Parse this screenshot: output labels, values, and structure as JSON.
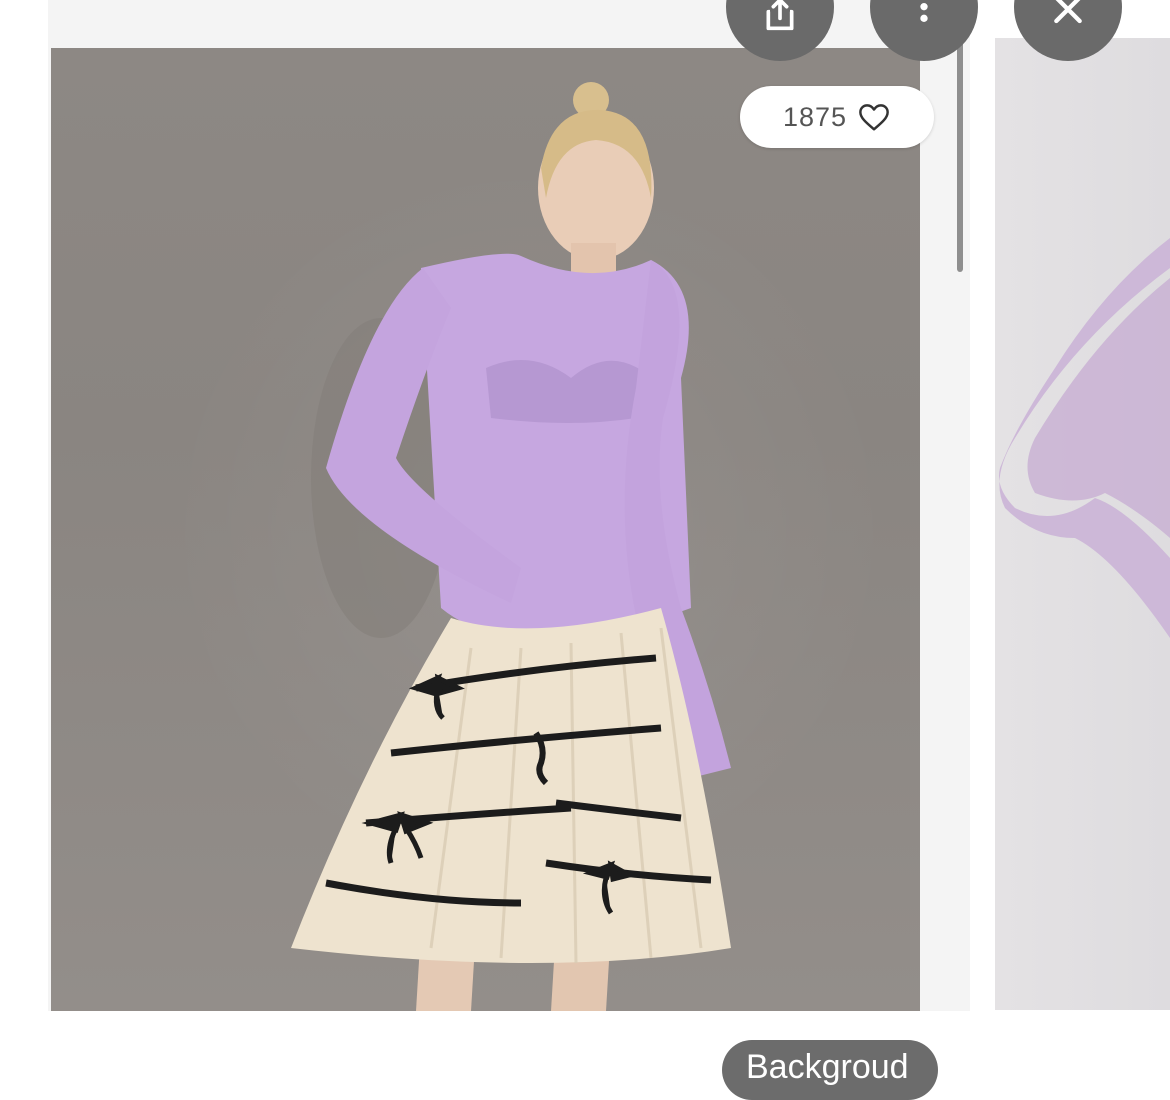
{
  "product_card": {
    "like_count": "1875",
    "like_icon": "heart-outline-icon"
  },
  "top_actions": [
    {
      "name": "share-button",
      "icon": "share-icon"
    },
    {
      "name": "more-options-button",
      "icon": "more-vertical-icon"
    },
    {
      "name": "close-button",
      "icon": "close-icon"
    }
  ],
  "bottom_button": {
    "label": "Backgroud"
  },
  "colors": {
    "photo_background": "#8d8884",
    "sweater": "#c6a7e0",
    "skirt": "#eee3cf",
    "stripes": "#1c1c1c",
    "button_gray": "#6a6a6a"
  }
}
